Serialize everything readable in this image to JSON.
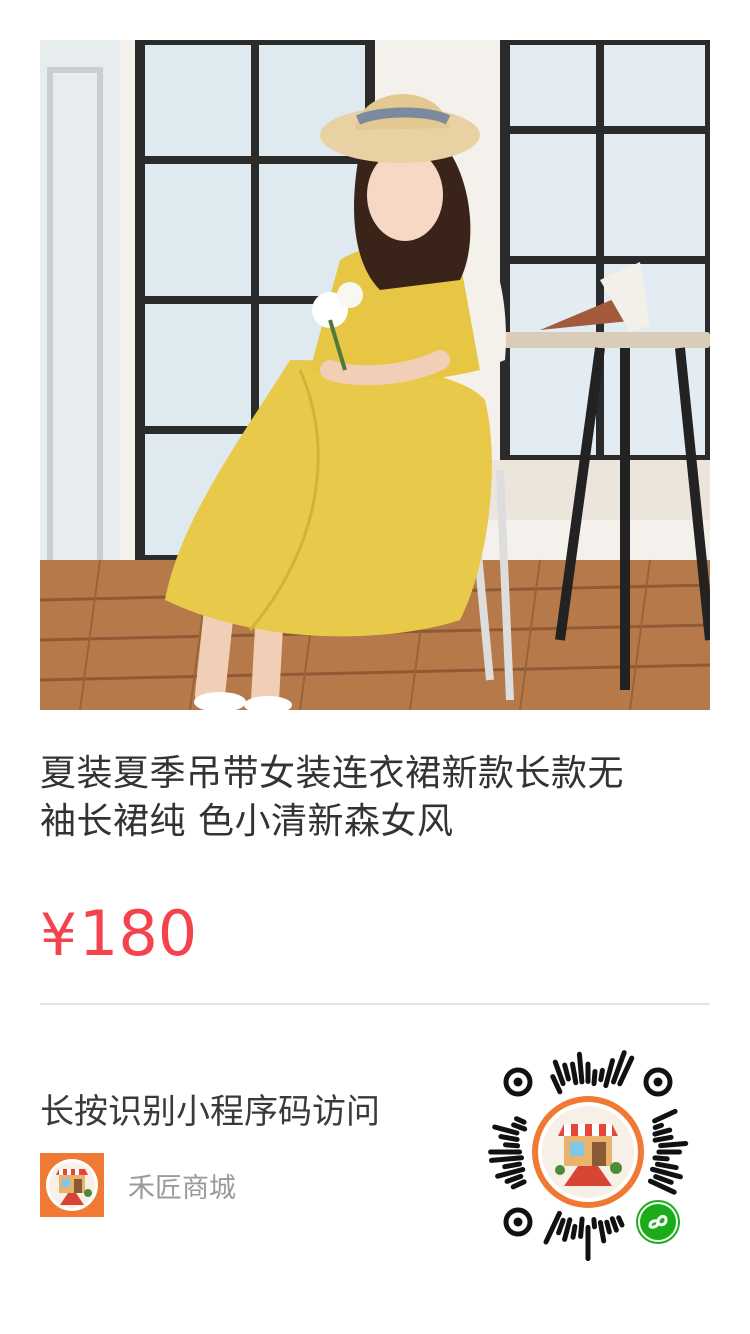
{
  "product": {
    "title_line1": "夏装夏季吊带女装连衣裙新款长款无",
    "title_line2": "袖长裙纯 色小清新森女风",
    "price_symbol": "¥",
    "price_value": "180",
    "image_icon": "product-photo-yellow-dress"
  },
  "footer": {
    "scan_tip": "长按识别小程序码访问",
    "store_name": "禾匠商城",
    "store_logo_icon": "shop-storefront-icon",
    "qr_icon": "mini-program-code-icon"
  },
  "colors": {
    "price": "#f4434d",
    "title": "#333333",
    "logo_orange": "#f07a33",
    "wechat_green": "#1aad19"
  }
}
